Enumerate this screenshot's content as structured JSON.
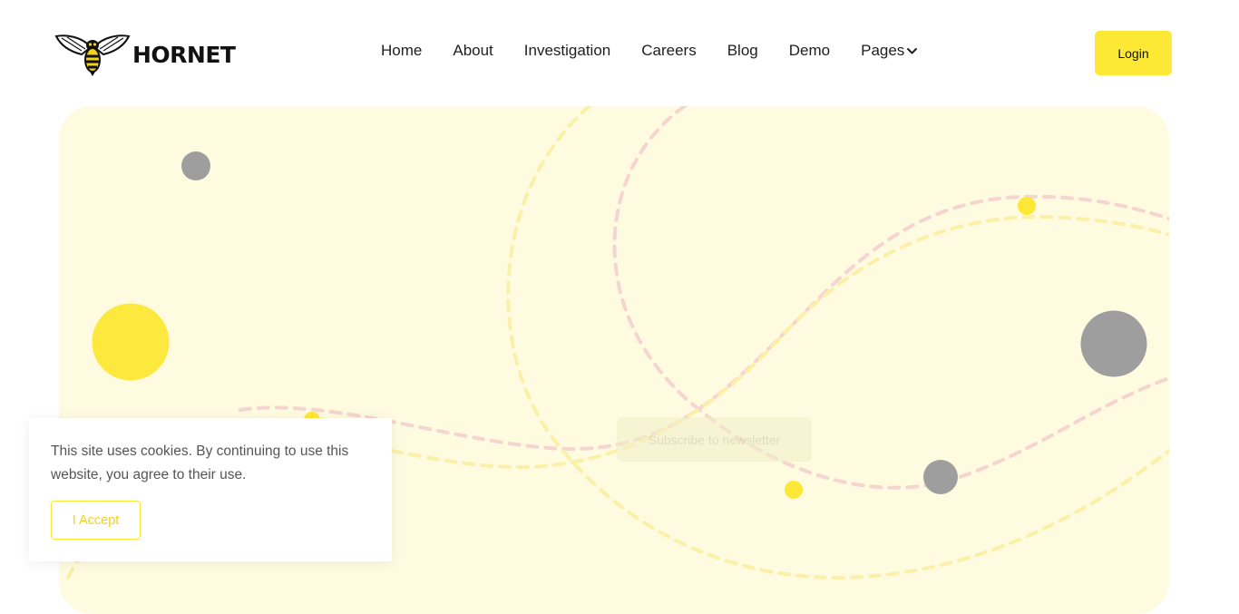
{
  "brand": {
    "name": "HORNET",
    "logo_icon": "hornet-icon"
  },
  "nav": {
    "items": [
      {
        "label": "Home"
      },
      {
        "label": "About"
      },
      {
        "label": "Investigation"
      },
      {
        "label": "Careers"
      },
      {
        "label": "Blog"
      },
      {
        "label": "Demo"
      },
      {
        "label": "Pages",
        "icon": "chevron-down-icon"
      }
    ]
  },
  "header": {
    "login_label": "Login"
  },
  "hero": {
    "subscribe_label": "Subscribe to newsletter"
  },
  "cookie_notice": {
    "text": "This site uses cookies. By continuing to use this website, you agree to their use.",
    "accept_label": "I Accept"
  },
  "colors": {
    "accent_yellow": "#fde835",
    "hero_background": "#fffbe0",
    "dot_gray": "#9e9e9e",
    "dash_pink": "#f6d4d0",
    "dash_yellow": "#fbf0a8"
  }
}
